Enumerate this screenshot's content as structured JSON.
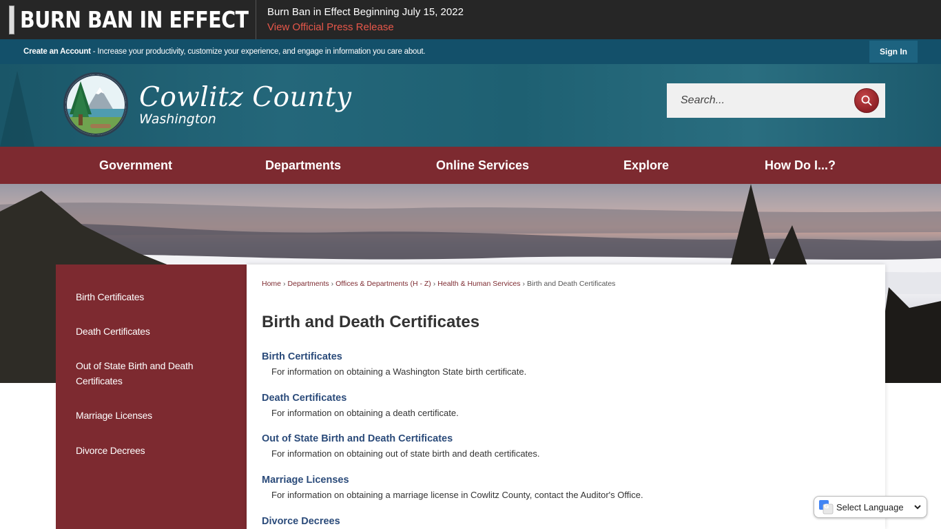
{
  "alert": {
    "title": "BURN BAN IN EFFECT",
    "message": "Burn Ban in Effect Beginning July 15, 2022",
    "link": "View Official Press Release"
  },
  "account": {
    "create_label": "Create an Account",
    "tagline": " - Increase your productivity, customize your experience, and engage in information you care about.",
    "signin": "Sign In"
  },
  "header": {
    "name": "Cowlitz County",
    "sub": "Washington",
    "search_placeholder": "Search..."
  },
  "nav": [
    "Government",
    "Departments",
    "Online Services",
    "Explore",
    "How Do I...?"
  ],
  "sidebar": [
    "Birth Certificates",
    "Death Certificates",
    "Out of State Birth and Death Certificates",
    "Marriage Licenses",
    "Divorce Decrees"
  ],
  "breadcrumb": {
    "items": [
      "Home",
      "Departments",
      "Offices & Departments (H - Z)",
      "Health & Human Services"
    ],
    "current": "Birth and Death Certificates",
    "separator": "›"
  },
  "page_title": "Birth and Death Certificates",
  "entries": [
    {
      "title": "Birth Certificates",
      "desc": "For information on obtaining a Washington State birth certificate."
    },
    {
      "title": "Death Certificates",
      "desc": "For information on obtaining a death certificate."
    },
    {
      "title": "Out of State Birth and Death Certificates",
      "desc": "For information on obtaining out of state birth and death certificates."
    },
    {
      "title": "Marriage Licenses",
      "desc": "For information on obtaining a marriage license in Cowlitz County, contact the Auditor's Office."
    },
    {
      "title": "Divorce Decrees",
      "desc": ""
    }
  ],
  "language": {
    "label": "Select Language"
  },
  "colors": {
    "brand_maroon": "#7d2a30",
    "teal": "#13506a",
    "link_blue": "#2b4b7a",
    "alert_red": "#e7574a"
  }
}
